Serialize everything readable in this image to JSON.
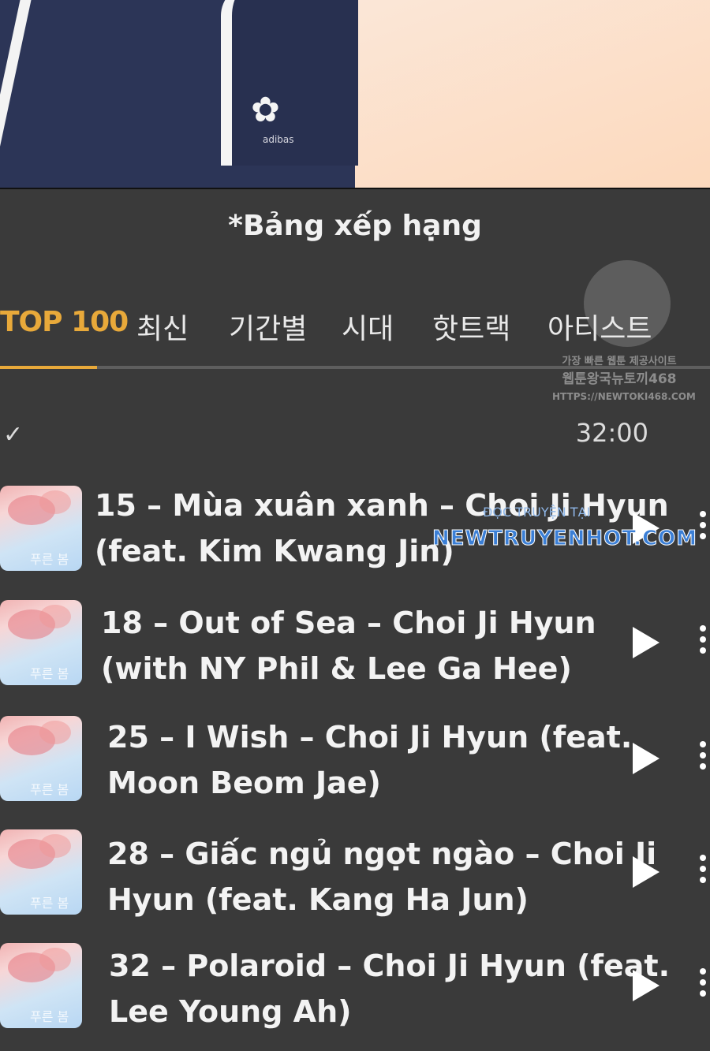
{
  "artwork": {
    "logo_glyph": "✿",
    "brand_text": "adibas"
  },
  "header": {
    "title": "*Bảng xếp hạng"
  },
  "tabs": [
    {
      "label": "TOP 100",
      "active": true
    },
    {
      "label": "최신",
      "active": false
    },
    {
      "label": "기간별",
      "active": false
    },
    {
      "label": "시대",
      "active": false
    },
    {
      "label": "핫트랙",
      "active": false
    },
    {
      "label": "아티스트",
      "active": false
    }
  ],
  "toolbar": {
    "check_icon": "check-icon",
    "check_glyph": "✓",
    "duration": "32:00"
  },
  "watermark": {
    "line1": "가장 빠른 웹툰 제공사이트",
    "line2": "웹툰왕국뉴토끼468",
    "line3": "HTTPS://NEWTOKI468.COM",
    "site_small": "ĐỌC TRUYỆN TẠI",
    "site": "NEWTRUYENHOT.COM"
  },
  "songs": [
    {
      "line1": "15 – Mùa xuân xanh – Choi Ji Hyun",
      "line2": "(feat. Kim Kwang Jin)",
      "thumb_label": "푸른 봄"
    },
    {
      "line1": "18 – Out of Sea – Choi Ji Hyun",
      "line2": "(with NY Phil & Lee Ga Hee)",
      "thumb_label": "푸른 봄"
    },
    {
      "line1": "25 – I Wish – Choi Ji Hyun (feat.",
      "line2": "Moon Beom Jae)",
      "thumb_label": "푸른 봄"
    },
    {
      "line1": "28 – Giấc ngủ ngọt ngào – Choi Ji",
      "line2": "Hyun (feat. Kang Ha Jun)",
      "thumb_label": "푸른 봄"
    },
    {
      "line1": "32 – Polaroid – Choi Ji Hyun (feat.",
      "line2": "Lee Young Ah)",
      "thumb_label": "푸른 봄"
    }
  ],
  "colors": {
    "accent": "#e8a93a",
    "background": "#3a3a3a",
    "text": "#f3f3f3"
  }
}
